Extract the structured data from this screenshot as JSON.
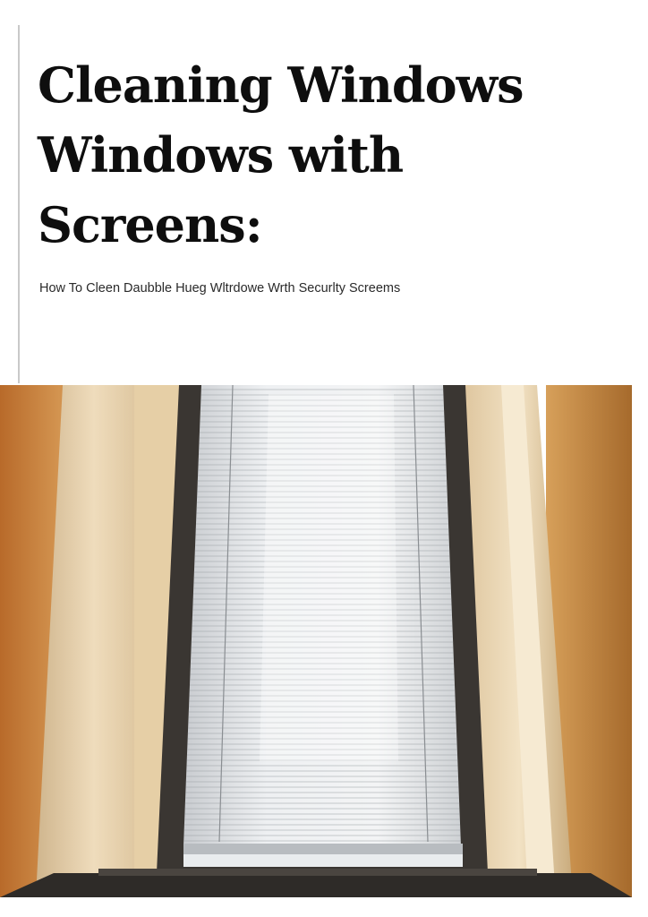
{
  "cover": {
    "title_lines": [
      "Cleaning Windows",
      "Windows with",
      "Screens:"
    ],
    "subtitle": "How To Cleen Daubble Hueg Wltrdowe Wrth Securlty Screems"
  },
  "photo": {
    "subject": "window-with-blinds-photo",
    "colors": {
      "wall_orange": "#c98a45",
      "trim_cream": "#e8d2ac",
      "frame_dark": "#3a3632",
      "blinds": "#e4e7ea",
      "sill": "#2e2b28"
    }
  }
}
